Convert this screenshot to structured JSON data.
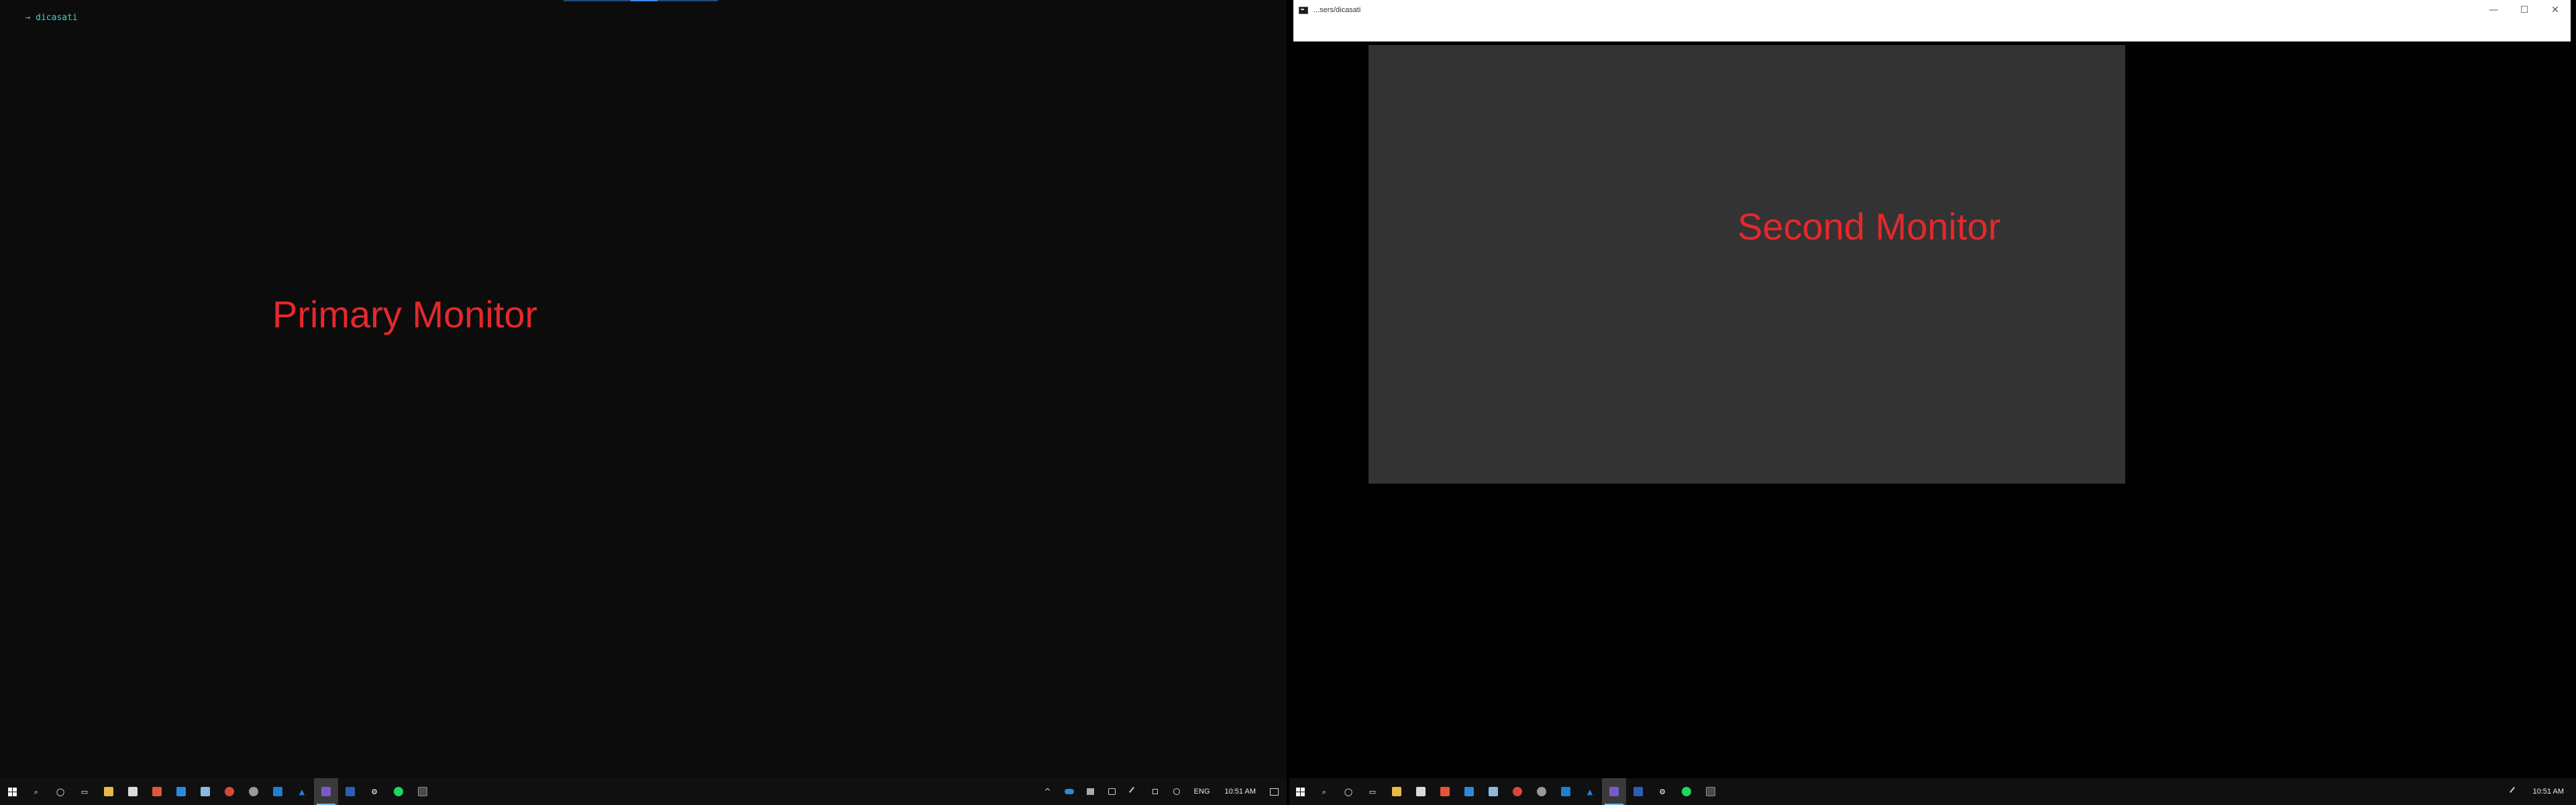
{
  "primary": {
    "terminal": {
      "arrow": "→",
      "prompt_text": "dicasati"
    },
    "label": "Primary Monitor",
    "taskbar": {
      "icons": [
        {
          "name": "start-icon",
          "glyph": "",
          "color": ""
        },
        {
          "name": "search-icon",
          "glyph": "⌕",
          "color": ""
        },
        {
          "name": "cortana-icon",
          "glyph": "◯",
          "color": ""
        },
        {
          "name": "task-view-icon",
          "glyph": "▭",
          "color": ""
        },
        {
          "name": "file-explorer-icon",
          "glyph": "",
          "color": "#e8b948"
        },
        {
          "name": "store-icon",
          "glyph": "",
          "color": "#dadada"
        },
        {
          "name": "app-red-icon",
          "glyph": "",
          "color": "#e2553b"
        },
        {
          "name": "app-blue-icon",
          "glyph": "",
          "color": "#2e8ad8"
        },
        {
          "name": "app-lightblue-icon",
          "glyph": "",
          "color": "#8fb8de"
        },
        {
          "name": "chrome-icon",
          "glyph": "●",
          "color": "#d84a38"
        },
        {
          "name": "app-gray-icon",
          "glyph": "",
          "color": "#9a9a9a"
        },
        {
          "name": "vscode-icon",
          "glyph": "",
          "color": "#1f7fd0"
        },
        {
          "name": "azure-icon",
          "glyph": "▲",
          "color": "#2a7fd4"
        },
        {
          "name": "app-active-icon",
          "glyph": "",
          "color": "#7a5ac8"
        },
        {
          "name": "word-icon",
          "glyph": "",
          "color": "#2b5fb5"
        },
        {
          "name": "settings-icon",
          "glyph": "⚙",
          "color": ""
        },
        {
          "name": "spotify-icon",
          "glyph": "●",
          "color": "#1ed760"
        },
        {
          "name": "terminal-icon",
          "glyph": "",
          "color": "#4a4a4a"
        }
      ],
      "tray": {
        "chevron": "^",
        "lang": "ENG",
        "clock": "10:51 AM"
      }
    }
  },
  "secondary": {
    "window": {
      "title": "...sers/dicasati",
      "minimize": "—",
      "maximize": "☐",
      "close": "✕"
    },
    "label": "Second Monitor",
    "taskbar": {
      "clock": "10:51 AM"
    }
  }
}
